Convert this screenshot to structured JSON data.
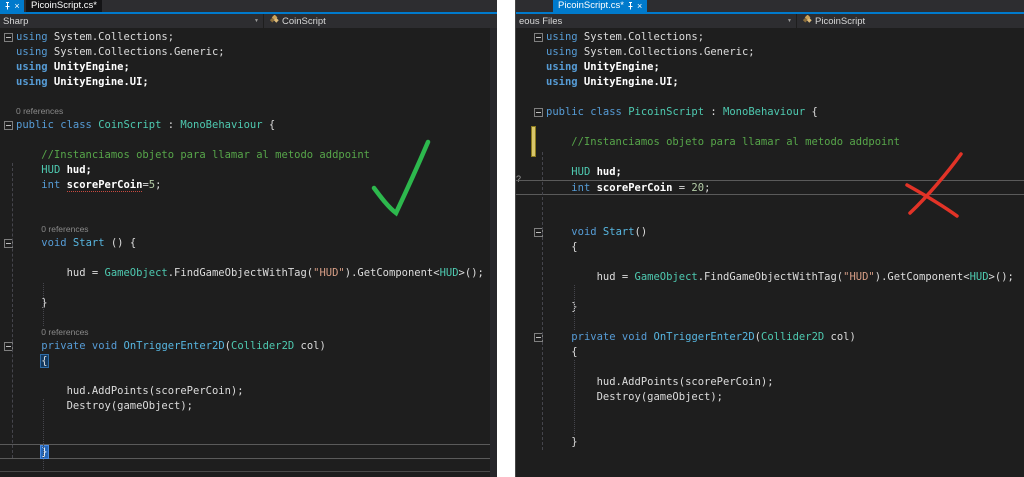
{
  "colors": {
    "accent_blue": "#007acc",
    "editor_background": "#1e1e1e",
    "check_green": "#2db84d",
    "cross_red": "#e23327",
    "modified_marker_yellow": "#d9c66a"
  },
  "overlays": {
    "left_annotation": "green-checkmark",
    "right_annotation": "red-cross"
  },
  "windows": {
    "left": {
      "tab_strip": {
        "active_tab_fragment_icons": [
          "pin-icon",
          "close-icon"
        ],
        "inactive_tab_label": "PicoinScript.cs*"
      },
      "nav": {
        "project_dropdown": "Sharp",
        "member_dropdown": "CoinScript"
      },
      "margin_glyphs": [],
      "code": [
        {
          "fold": true,
          "t": [
            [
              "k",
              "using"
            ],
            [
              "p",
              " System.Collections;"
            ]
          ]
        },
        {
          "t": [
            [
              "k",
              "using"
            ],
            [
              "p",
              " System.Collections.Generic;"
            ]
          ]
        },
        {
          "t": [
            [
              "kb",
              "using"
            ],
            [
              "b",
              " UnityEngine;"
            ]
          ]
        },
        {
          "t": [
            [
              "kb",
              "using"
            ],
            [
              "b",
              " UnityEngine.UI;"
            ]
          ]
        },
        {
          "t": []
        },
        {
          "cl": "codelens",
          "t": [
            [
              "g",
              "0 references"
            ]
          ]
        },
        {
          "fold": true,
          "t": [
            [
              "k",
              "public"
            ],
            [
              "p",
              " "
            ],
            [
              "k",
              "class"
            ],
            [
              "p",
              " "
            ],
            [
              "t",
              "CoinScript"
            ],
            [
              "p",
              " : "
            ],
            [
              "t",
              "MonoBehaviour"
            ],
            [
              "p",
              " {"
            ]
          ]
        },
        {
          "t": []
        },
        {
          "t": [
            [
              "c",
              "    //Instanciamos objeto para llamar al metodo addpoint"
            ]
          ]
        },
        {
          "t": [
            [
              "p",
              "    "
            ],
            [
              "t",
              "HUD"
            ],
            [
              "b",
              " hud;"
            ]
          ]
        },
        {
          "t": [
            [
              "p",
              "    "
            ],
            [
              "k",
              "int"
            ],
            [
              "p",
              " "
            ],
            [
              "b sq",
              "scorePerCoin"
            ],
            [
              "p",
              "="
            ],
            [
              "n",
              "5"
            ],
            [
              "p",
              ";"
            ]
          ]
        },
        {
          "t": []
        },
        {
          "t": []
        },
        {
          "cl": "codelens",
          "t": [
            [
              "ind",
              "    "
            ],
            [
              "g",
              "0 references"
            ]
          ]
        },
        {
          "fold": true,
          "t": [
            [
              "p",
              "    "
            ],
            [
              "k",
              "void"
            ],
            [
              "p",
              " "
            ],
            [
              "m",
              "Start"
            ],
            [
              "p",
              " () {"
            ]
          ]
        },
        {
          "t": []
        },
        {
          "t": [
            [
              "p",
              "        hud = "
            ],
            [
              "t",
              "GameObject"
            ],
            [
              "p",
              ".FindGameObjectWithTag("
            ],
            [
              "s",
              "\"HUD\""
            ],
            [
              "p",
              ").GetComponent<"
            ],
            [
              "t",
              "HUD"
            ],
            [
              "p",
              ">();"
            ]
          ]
        },
        {
          "t": []
        },
        {
          "t": [
            [
              "p",
              "    }"
            ]
          ]
        },
        {
          "t": []
        },
        {
          "cl": "codelens",
          "t": [
            [
              "ind",
              "    "
            ],
            [
              "g",
              "0 references"
            ]
          ]
        },
        {
          "fold": true,
          "t": [
            [
              "p",
              "    "
            ],
            [
              "k",
              "private"
            ],
            [
              "p",
              " "
            ],
            [
              "k",
              "void"
            ],
            [
              "p",
              " "
            ],
            [
              "m",
              "OnTriggerEnter2D"
            ],
            [
              "p",
              "("
            ],
            [
              "t",
              "Collider2D"
            ],
            [
              "p",
              " col)"
            ]
          ]
        },
        {
          "t": [
            [
              "p",
              "    "
            ],
            [
              "sel1",
              "{"
            ]
          ]
        },
        {
          "t": []
        },
        {
          "t": [
            [
              "p",
              "        hud.AddPoints(scorePerCoin);"
            ]
          ]
        },
        {
          "t": [
            [
              "p",
              "        Destroy(gameObject);"
            ]
          ]
        },
        {
          "t": []
        },
        {
          "t": []
        },
        {
          "cur": true,
          "t": [
            [
              "p",
              "    "
            ],
            [
              "sel2",
              "}"
            ]
          ]
        },
        {
          "t": []
        }
      ]
    },
    "right": {
      "tab_strip": {
        "active_tab_label": "PicoinScript.cs*",
        "active_tab_icons": [
          "pin-icon",
          "close-icon"
        ]
      },
      "nav": {
        "project_dropdown": "eous Files",
        "member_dropdown": "PicoinScript"
      },
      "margin_glyphs": [
        "?"
      ],
      "code": [
        {
          "fold": true,
          "t": [
            [
              "k",
              "using"
            ],
            [
              "p",
              " System.Collections;"
            ]
          ]
        },
        {
          "t": [
            [
              "k",
              "using"
            ],
            [
              "p",
              " System.Collections.Generic;"
            ]
          ]
        },
        {
          "t": [
            [
              "kb",
              "using"
            ],
            [
              "b",
              " UnityEngine;"
            ]
          ]
        },
        {
          "t": [
            [
              "kb",
              "using"
            ],
            [
              "b",
              " UnityEngine.UI;"
            ]
          ]
        },
        {
          "t": []
        },
        {
          "fold": true,
          "t": [
            [
              "k",
              "public"
            ],
            [
              "p",
              " "
            ],
            [
              "k",
              "class"
            ],
            [
              "p",
              " "
            ],
            [
              "t",
              "PicoinScript"
            ],
            [
              "p",
              " : "
            ],
            [
              "t",
              "MonoBehaviour"
            ],
            [
              "p",
              " {"
            ]
          ]
        },
        {
          "t": []
        },
        {
          "t": [
            [
              "c",
              "    //Instanciamos objeto para llamar al metodo addpoint"
            ]
          ]
        },
        {
          "t": []
        },
        {
          "t": [
            [
              "p",
              "    "
            ],
            [
              "t",
              "HUD"
            ],
            [
              "b",
              " hud;"
            ]
          ]
        },
        {
          "cur": true,
          "t": [
            [
              "p",
              "    "
            ],
            [
              "k",
              "int"
            ],
            [
              "b",
              " scorePerCoin"
            ],
            [
              "p",
              " = "
            ],
            [
              "n",
              "20"
            ],
            [
              "p",
              ";"
            ]
          ]
        },
        {
          "t": []
        },
        {
          "t": []
        },
        {
          "fold": true,
          "t": [
            [
              "p",
              "    "
            ],
            [
              "k",
              "void"
            ],
            [
              "p",
              " "
            ],
            [
              "m",
              "Start"
            ],
            [
              "p",
              "()"
            ]
          ]
        },
        {
          "t": [
            [
              "p",
              "    {"
            ]
          ]
        },
        {
          "t": []
        },
        {
          "t": [
            [
              "p",
              "        hud = "
            ],
            [
              "t",
              "GameObject"
            ],
            [
              "p",
              ".FindGameObjectWithTag("
            ],
            [
              "s",
              "\"HUD\""
            ],
            [
              "p",
              ").GetComponent<"
            ],
            [
              "t",
              "HUD"
            ],
            [
              "p",
              ">();"
            ]
          ]
        },
        {
          "t": []
        },
        {
          "t": [
            [
              "p",
              "    }"
            ]
          ]
        },
        {
          "t": []
        },
        {
          "fold": true,
          "t": [
            [
              "p",
              "    "
            ],
            [
              "k",
              "private"
            ],
            [
              "p",
              " "
            ],
            [
              "k",
              "void"
            ],
            [
              "p",
              " "
            ],
            [
              "m",
              "OnTriggerEnter2D"
            ],
            [
              "p",
              "("
            ],
            [
              "t",
              "Collider2D"
            ],
            [
              "p",
              " col)"
            ]
          ]
        },
        {
          "t": [
            [
              "p",
              "    {"
            ]
          ]
        },
        {
          "t": []
        },
        {
          "t": [
            [
              "p",
              "        hud.AddPoints(scorePerCoin);"
            ]
          ]
        },
        {
          "t": [
            [
              "p",
              "        Destroy(gameObject);"
            ]
          ]
        },
        {
          "t": []
        },
        {
          "t": []
        },
        {
          "t": [
            [
              "p",
              "    }"
            ]
          ]
        }
      ]
    }
  }
}
